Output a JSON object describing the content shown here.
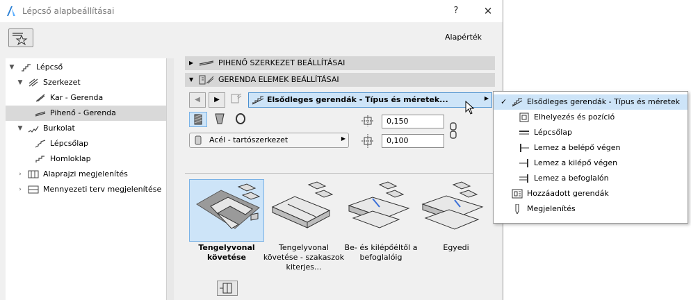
{
  "window": {
    "title": "Lépcső alapbeállításai",
    "help": "?",
    "close": "✕",
    "default_label": "Alapérték"
  },
  "tree": {
    "items": [
      {
        "label": "Lépcső",
        "chev": "▼"
      },
      {
        "label": "Szerkezet",
        "chev": "▼"
      },
      {
        "label": "Kar - Gerenda"
      },
      {
        "label": "Pihenő - Gerenda"
      },
      {
        "label": "Burkolat",
        "chev": "▼"
      },
      {
        "label": "Lépcsőlap"
      },
      {
        "label": "Homloklap"
      },
      {
        "label": "Alaprajzi megjelenítés",
        "chev": "›"
      },
      {
        "label": "Mennyezeti terv megjelenítése",
        "chev": "›"
      }
    ],
    "selected_index": 3
  },
  "sections": {
    "landing": "PIHENŐ SZERKEZET BEÁLLÍTÁSAI",
    "beam": "GERENDA ELEMEK BEÁLLÍTÁSAI"
  },
  "toolbar": {
    "prev": "◀",
    "next": "▶",
    "dropdown_label": "Elsődleges gerendák - Típus és méretek...",
    "dropdown_arrow": "▶"
  },
  "material": {
    "label": "Acél - tartószerkezet",
    "arrow": "▶"
  },
  "fields": {
    "width": "0,150",
    "height": "0,100"
  },
  "options": [
    {
      "label": "Tengelyvonal követése",
      "selected": true
    },
    {
      "label": "Tengelyvonal követése - szakaszok kiterjes..."
    },
    {
      "label": "Be- és kilépőéltől a befoglalóig"
    },
    {
      "label": "Egyedi"
    }
  ],
  "menu": {
    "items": [
      {
        "label": "Elsődleges gerendák - Típus és méretek",
        "check": "✓"
      },
      {
        "label": "Elhelyezés és pozíció"
      },
      {
        "label": "Lépcsőlap"
      },
      {
        "label": "Lemez a belépő végen"
      },
      {
        "label": "Lemez a kilépő végen"
      },
      {
        "label": "Lemez a befoglalón"
      },
      {
        "label": "Hozzáadott gerendák"
      },
      {
        "label": "Megjelenítés"
      }
    ],
    "selected_index": 0
  },
  "colors": {
    "selection": "#cde4f8",
    "accent": "#4a90d0",
    "tree_selected": "#d9d9d9"
  }
}
